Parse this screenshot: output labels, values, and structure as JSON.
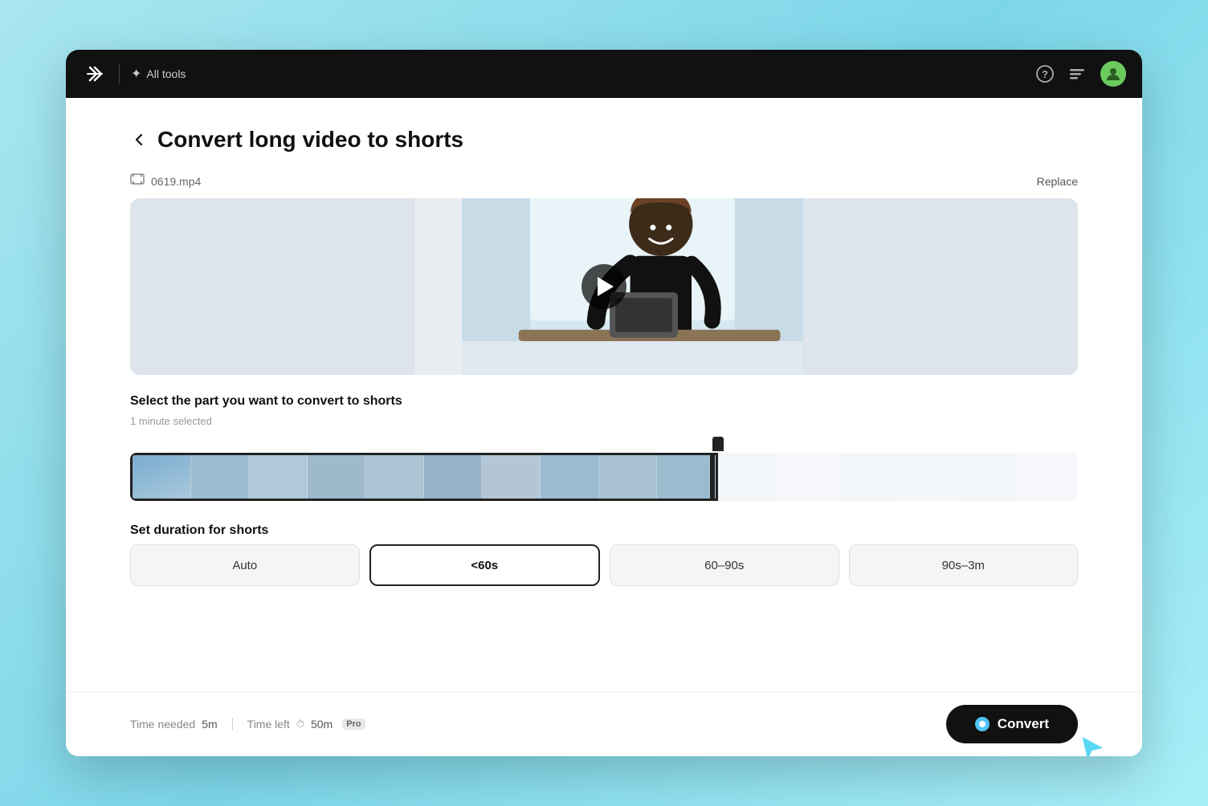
{
  "header": {
    "logo_symbol": "✂",
    "all_tools_label": "All tools",
    "help_icon": "?",
    "menu_icon": "≡"
  },
  "page": {
    "back_label": "‹",
    "title": "Convert long video to shorts",
    "file_name": "0619.mp4",
    "replace_label": "Replace"
  },
  "timeline": {
    "selection_label": "Select the part you want to convert to shorts",
    "selected_duration": "1 minute selected"
  },
  "duration": {
    "section_label": "Set duration for shorts",
    "options": [
      {
        "label": "Auto",
        "active": false
      },
      {
        "label": "<60s",
        "active": true
      },
      {
        "label": "60–90s",
        "active": false
      },
      {
        "label": "90s–3m",
        "active": false
      }
    ]
  },
  "footer": {
    "time_needed_label": "Time needed",
    "time_needed_value": "5m",
    "time_left_label": "Time left",
    "time_left_value": "50m",
    "pro_label": "Pro",
    "convert_label": "Convert"
  }
}
